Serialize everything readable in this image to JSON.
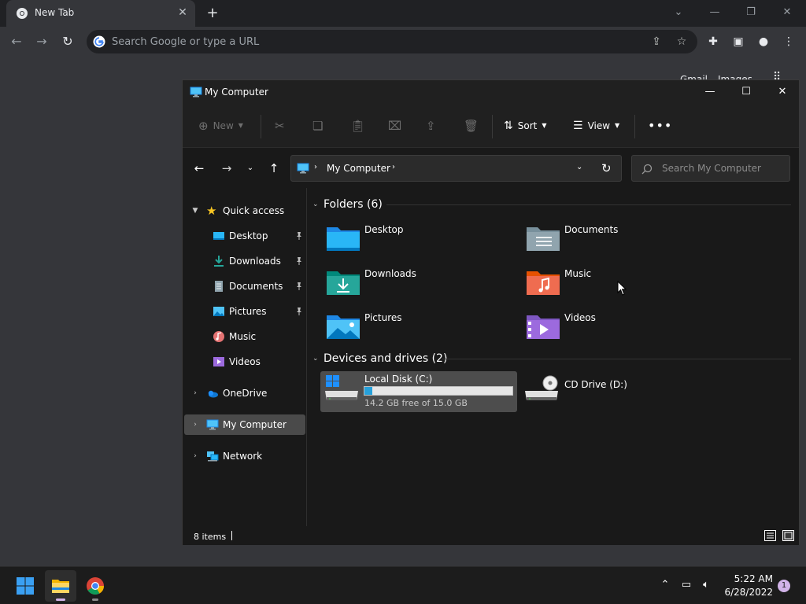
{
  "chrome": {
    "tab_title": "New Tab",
    "omnibox_placeholder": "Search Google or type a URL",
    "ntp_links": [
      "Gmail",
      "Images"
    ],
    "colors": {
      "background": "#202124",
      "toolbar": "#35363a"
    }
  },
  "explorer": {
    "title": "My Computer",
    "toolbar": {
      "new_label": "New",
      "sort_label": "Sort",
      "view_label": "View"
    },
    "address": {
      "location": "My Computer"
    },
    "search": {
      "placeholder": "Search My Computer"
    },
    "nav": {
      "quick_access": "Quick access",
      "pinned": [
        {
          "label": "Desktop",
          "icon": "desktop-icon",
          "pinned": true
        },
        {
          "label": "Downloads",
          "icon": "downloads-icon",
          "pinned": true
        },
        {
          "label": "Documents",
          "icon": "documents-icon",
          "pinned": true
        },
        {
          "label": "Pictures",
          "icon": "pictures-icon",
          "pinned": true
        },
        {
          "label": "Music",
          "icon": "music-icon",
          "pinned": false
        },
        {
          "label": "Videos",
          "icon": "videos-icon",
          "pinned": false
        }
      ],
      "onedrive": "OneDrive",
      "my_computer": "My Computer",
      "network": "Network"
    },
    "folders": {
      "header": "Folders (6)",
      "items": [
        {
          "label": "Desktop",
          "icon": "desktop-folder-icon"
        },
        {
          "label": "Documents",
          "icon": "documents-folder-icon"
        },
        {
          "label": "Downloads",
          "icon": "downloads-folder-icon"
        },
        {
          "label": "Music",
          "icon": "music-folder-icon"
        },
        {
          "label": "Pictures",
          "icon": "pictures-folder-icon"
        },
        {
          "label": "Videos",
          "icon": "videos-folder-icon"
        }
      ]
    },
    "drives": {
      "header": "Devices and drives (2)",
      "items": [
        {
          "label": "Local Disk (C:)",
          "free_text": "14.2 GB free of 15.0 GB",
          "used_fraction": 0.053,
          "selected": true
        },
        {
          "label": "CD Drive (D:)",
          "selected": false
        }
      ]
    },
    "status": {
      "item_count": "8 items"
    },
    "colors": {
      "accent": "#26a0da",
      "selection": "#4d4d4d",
      "window_bg": "#191919"
    }
  },
  "taskbar": {
    "time": "5:22 AM",
    "date": "6/28/2022",
    "notification_count": "1"
  }
}
